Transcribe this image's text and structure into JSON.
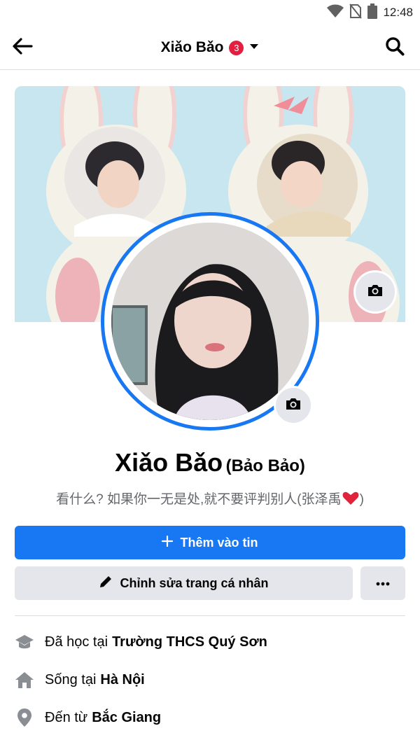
{
  "status_bar": {
    "time": "12:48",
    "icons": [
      "wifi-icon",
      "no-sim-icon",
      "battery-icon"
    ]
  },
  "header": {
    "title": "Xiǎo Bǎo",
    "badge_count": "3",
    "icons": [
      "back-arrow-icon",
      "caret-down-icon",
      "search-icon"
    ]
  },
  "profile": {
    "name": "Xiǎo Bǎo",
    "alternate_name": "(Bảo Bảo)",
    "bio": "看什么? 如果你一无是处,就不要评判别人(张泽禹",
    "bio_end": ")"
  },
  "actions": {
    "add_story_label": "Thêm vào tin",
    "edit_profile_label": "Chỉnh sửa trang cá nhân",
    "more_icon": "more-dots-icon"
  },
  "details": [
    {
      "icon": "education-icon",
      "prefix": "Đã học tại",
      "value": "Trường THCS Quý Sơn"
    },
    {
      "icon": "home-icon",
      "prefix": "Sống tại",
      "value": "Hà Nội"
    },
    {
      "icon": "location-pin-icon",
      "prefix": "Đến từ",
      "value": "Bắc Giang"
    }
  ],
  "colors": {
    "primary": "#1877f2",
    "badge": "#e41e3f",
    "secondary_button": "#e4e6eb",
    "muted_text": "#65676b"
  }
}
